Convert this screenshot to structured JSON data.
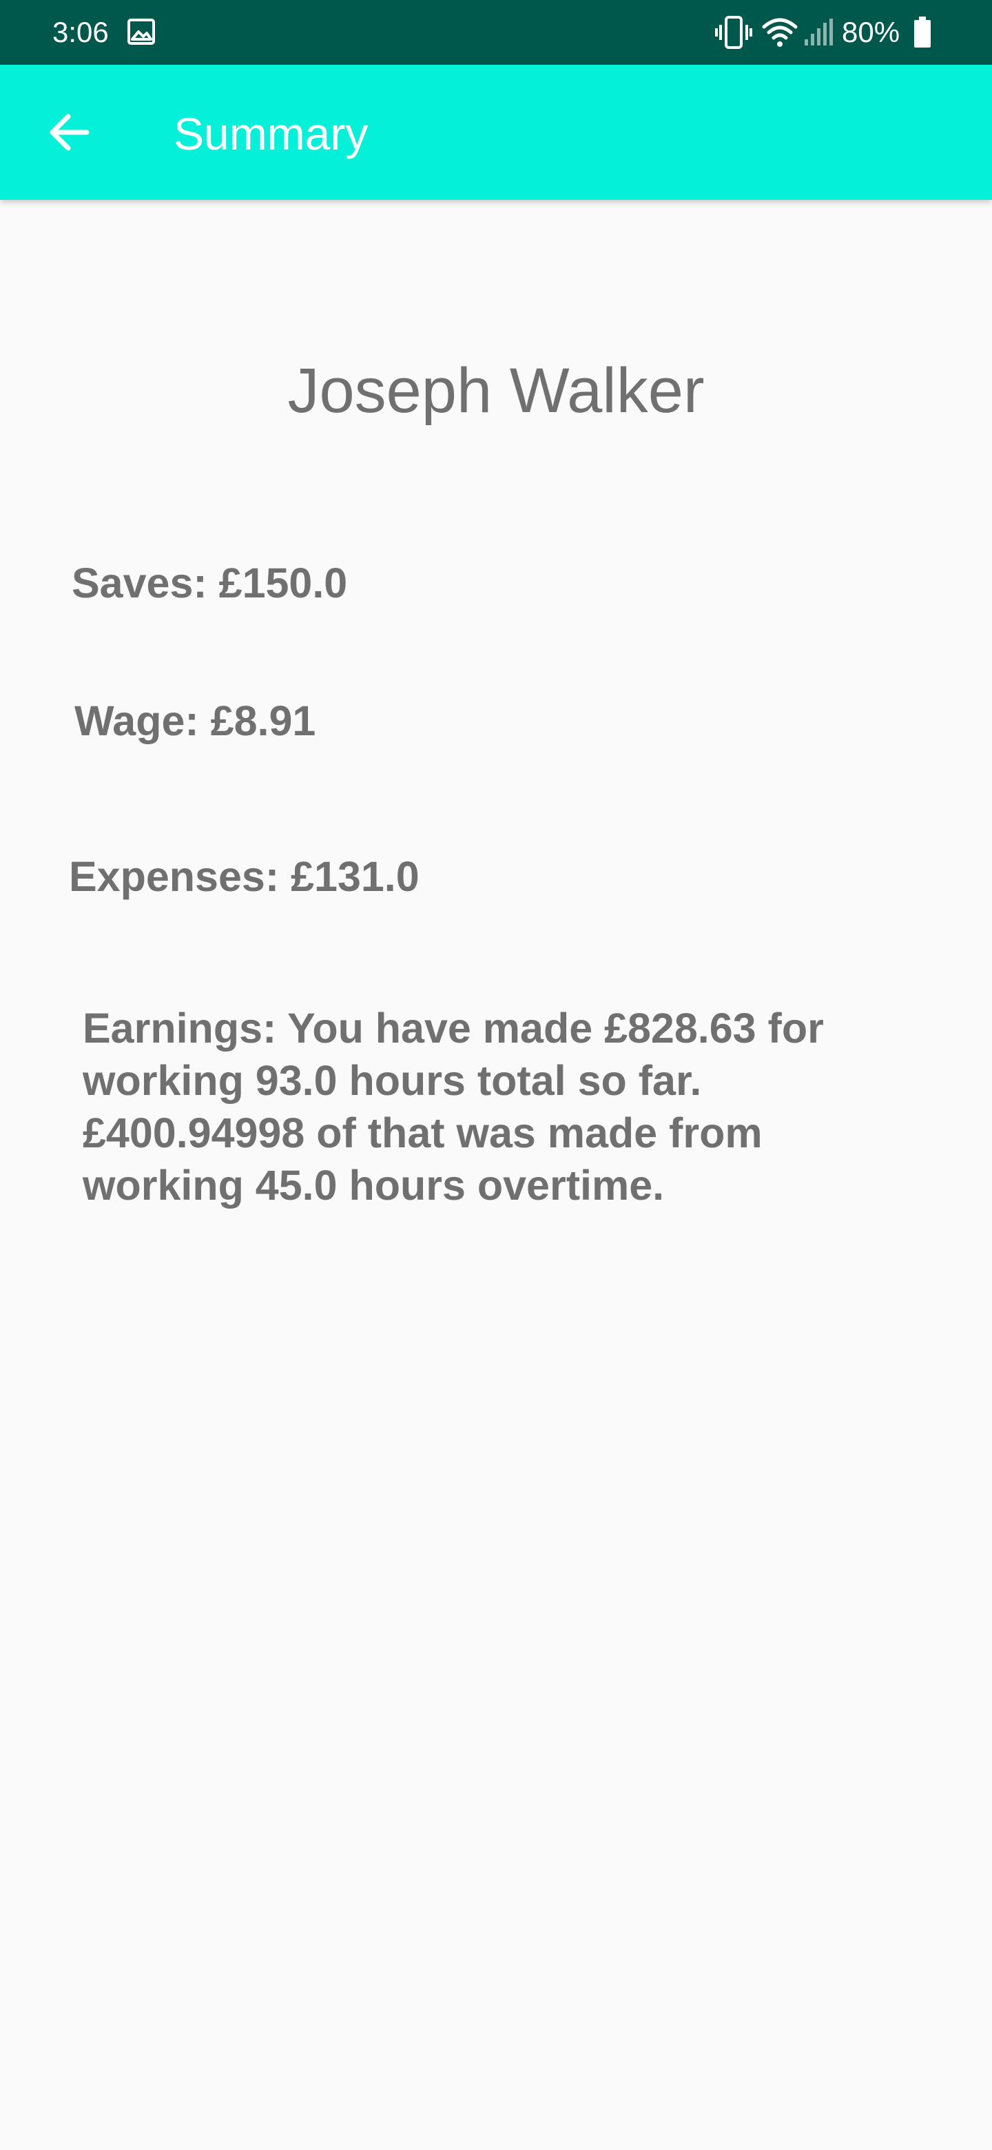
{
  "status_bar": {
    "time": "3:06",
    "battery": "80%",
    "icons": [
      "gallery-icon",
      "vibrate-icon",
      "wifi-icon",
      "signal-icon",
      "battery-icon"
    ],
    "background_color": "#00574b"
  },
  "app_bar": {
    "title": "Summary",
    "back_icon": "arrow-left-icon",
    "background_color": "#05f0d8"
  },
  "summary": {
    "name": "Joseph Walker",
    "saves": "Saves: £150.0",
    "wage": "Wage: £8.91",
    "expenses": "Expenses: £131.0",
    "earnings": "Earnings: You have made £828.63 for working 93.0 hours total so far. £400.94998 of that was made from working 45.0 hours overtime."
  }
}
